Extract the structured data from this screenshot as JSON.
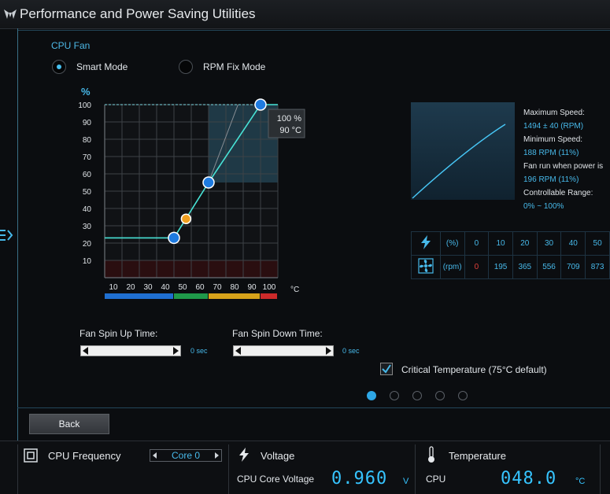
{
  "window": {
    "title": "Performance and Power Saving Utilities"
  },
  "section_title": "CPU Fan",
  "modes": {
    "smart": "Smart Mode",
    "rpm_fix": "RPM Fix Mode",
    "selected": "smart"
  },
  "chart_data": {
    "type": "line",
    "ylabel": "%",
    "xlabel_unit": "°C",
    "x_ticks": [
      "10",
      "20",
      "30",
      "40",
      "50",
      "60",
      "70",
      "80",
      "90",
      "100"
    ],
    "y_ticks": [
      "100",
      "90",
      "80",
      "70",
      "60",
      "50",
      "40",
      "30",
      "20",
      "10"
    ],
    "xlim": [
      0,
      100
    ],
    "ylim": [
      0,
      100
    ],
    "series": [
      {
        "points": [
          [
            0,
            23
          ],
          [
            40,
            23
          ],
          [
            60,
            55
          ],
          [
            90,
            100
          ],
          [
            100,
            100
          ]
        ]
      }
    ],
    "control_points": [
      [
        40,
        23,
        "blue"
      ],
      [
        47,
        34,
        "orange"
      ],
      [
        60,
        55,
        "blue"
      ],
      [
        90,
        100,
        "blue"
      ]
    ],
    "tooltip": {
      "value": "100 %",
      "temp": "90 °C"
    },
    "color_bands": [
      {
        "from": 0,
        "to": 40,
        "color": "#1f6fd1"
      },
      {
        "from": 40,
        "to": 60,
        "color": "#1f9a4a"
      },
      {
        "from": 60,
        "to": 90,
        "color": "#d7a21a"
      },
      {
        "from": 90,
        "to": 100,
        "color": "#cc2a2a"
      }
    ]
  },
  "info": {
    "max_speed_label": "Maximum Speed:",
    "max_speed_value": "1494 ± 40 (RPM)",
    "min_speed_label": "Minimum Speed:",
    "min_speed_value": "188 RPM (11%)",
    "fan_run_label": "Fan run when power is",
    "fan_run_value": "196 RPM (11%)",
    "range_label": "Controllable Range:",
    "range_value": "0% ~ 100%"
  },
  "rpm_table": {
    "percent_unit": "(%)",
    "rpm_unit": "(rpm)",
    "percent_values": [
      "0",
      "10",
      "20",
      "30",
      "40",
      "50"
    ],
    "rpm_values": [
      "0",
      "195",
      "365",
      "556",
      "709",
      "873"
    ]
  },
  "spin_up": {
    "label": "Fan Spin Up Time:",
    "value": "0 sec"
  },
  "spin_down": {
    "label": "Fan Spin Down Time:",
    "value": "0 sec"
  },
  "critical_temp": {
    "label": "Critical Temperature (75°C default)",
    "checked": true
  },
  "pagination": {
    "count": 5,
    "active": 0
  },
  "back_button": "Back",
  "status": {
    "cpu_freq_label": "CPU Frequency",
    "core_select": "Core 0",
    "voltage_label": "Voltage",
    "voltage_sub": "CPU Core Voltage",
    "voltage_value": "0.960",
    "voltage_unit": "V",
    "temp_label": "Temperature",
    "temp_sub": "CPU",
    "temp_value": "048.0",
    "temp_unit": "°C"
  }
}
